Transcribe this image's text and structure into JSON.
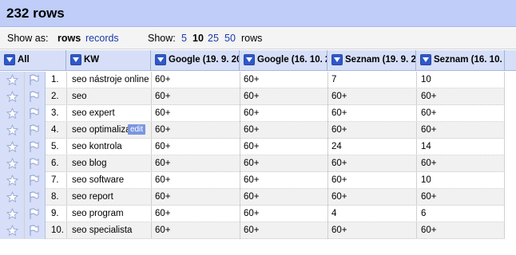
{
  "title": "232 rows",
  "controls": {
    "show_as_label": "Show as:",
    "rows_mode": "rows",
    "records_mode": "records",
    "show_label": "Show:",
    "page_sizes": [
      "5",
      "10",
      "25",
      "50"
    ],
    "selected_page_size": "10",
    "rows_suffix": "rows"
  },
  "columns": {
    "all": "All",
    "kw": "KW",
    "c1": "Google (19. 9. 20",
    "c2": "Google (16. 10. 2",
    "c3": "Seznam (19. 9. 2",
    "c4": "Seznam (16. 10."
  },
  "edit_badge": "edit",
  "table_rows": [
    {
      "idx": "1.",
      "kw": "seo nástroje online",
      "c1": "60+",
      "c2": "60+",
      "c3": "7",
      "c4": "10"
    },
    {
      "idx": "2.",
      "kw": "seo",
      "c1": "60+",
      "c2": "60+",
      "c3": "60+",
      "c4": "60+"
    },
    {
      "idx": "3.",
      "kw": "seo expert",
      "c1": "60+",
      "c2": "60+",
      "c3": "60+",
      "c4": "60+"
    },
    {
      "idx": "4.",
      "kw": "seo optimaliza",
      "c1": "60+",
      "c2": "60+",
      "c3": "60+",
      "c4": "60+"
    },
    {
      "idx": "5.",
      "kw": "seo kontrola",
      "c1": "60+",
      "c2": "60+",
      "c3": "24",
      "c4": "14"
    },
    {
      "idx": "6.",
      "kw": "seo blog",
      "c1": "60+",
      "c2": "60+",
      "c3": "60+",
      "c4": "60+"
    },
    {
      "idx": "7.",
      "kw": "seo software",
      "c1": "60+",
      "c2": "60+",
      "c3": "60+",
      "c4": "10"
    },
    {
      "idx": "8.",
      "kw": "seo report",
      "c1": "60+",
      "c2": "60+",
      "c3": "60+",
      "c4": "60+"
    },
    {
      "idx": "9.",
      "kw": "seo program",
      "c1": "60+",
      "c2": "60+",
      "c3": "4",
      "c4": "6"
    },
    {
      "idx": "10.",
      "kw": "seo specialista",
      "c1": "60+",
      "c2": "60+",
      "c3": "60+",
      "c4": "60+"
    }
  ]
}
